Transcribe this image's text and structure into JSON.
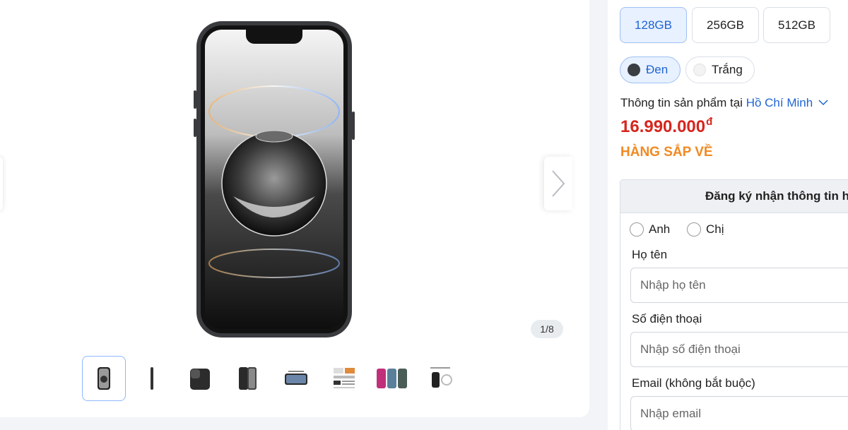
{
  "gallery": {
    "counter": "1/8",
    "thumbnails": [
      {
        "name": "phone-front"
      },
      {
        "name": "phone-side"
      },
      {
        "name": "phone-back-camera"
      },
      {
        "name": "phone-front-back"
      },
      {
        "name": "phone-landscape"
      },
      {
        "name": "spec-sheet"
      },
      {
        "name": "color-cases"
      },
      {
        "name": "box-contents"
      }
    ]
  },
  "storage_options": [
    {
      "label": "128GB",
      "selected": true
    },
    {
      "label": "256GB",
      "selected": false
    },
    {
      "label": "512GB",
      "selected": false
    }
  ],
  "color_options": [
    {
      "label": "Đen",
      "swatch": "#3a3d42",
      "selected": true
    },
    {
      "label": "Trắng",
      "swatch": "#f3f3f3",
      "selected": false
    }
  ],
  "product": {
    "info_prefix": "Thông tin sản phẩm tại",
    "city": "Hồ Chí Minh",
    "price": "16.990.000",
    "currency": "đ",
    "status": "HÀNG SẮP VỀ"
  },
  "form": {
    "title": "Đăng ký nhận thông tin hàng về",
    "salutation_male": "Anh",
    "salutation_female": "Chị",
    "name_label": "Họ tên",
    "name_placeholder": "Nhập họ tên",
    "phone_label": "Số điện thoại",
    "phone_placeholder": "Nhập số điện thoại",
    "email_label": "Email (không bắt buộc)",
    "email_placeholder": "Nhập email"
  },
  "colors": {
    "accent_blue": "#1f64d4",
    "price_red": "#d6261e",
    "status_orange": "#f08a24"
  }
}
